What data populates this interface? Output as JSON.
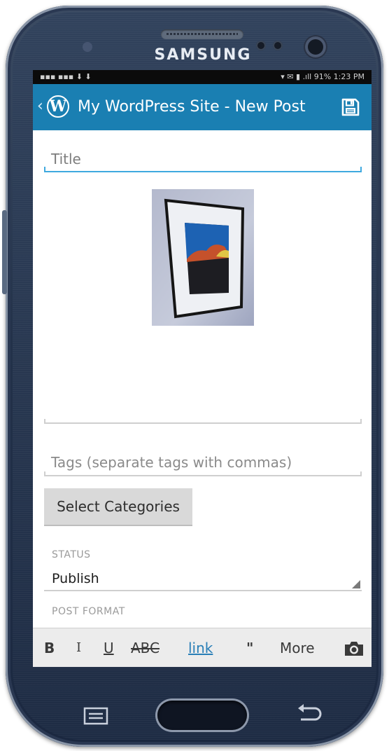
{
  "device": {
    "brand": "SAMSUNG"
  },
  "statusbar": {
    "left": "▪▪▪ ▪▪▪ ⬇ ⬇",
    "right": "▾ ✉ ▮ .ıll 91%  1:23 PM"
  },
  "actionbar": {
    "title": "My WordPress Site - New Post",
    "logo": "W",
    "background_color": "#1a7fb2",
    "back_icon": "chevron-left-icon",
    "save_icon": "floppy-disk-icon"
  },
  "editor": {
    "title_placeholder": "Title",
    "tags_placeholder": "Tags (separate tags with commas)",
    "select_categories_label": "Select Categories",
    "status_label": "STATUS",
    "status_value": "Publish",
    "post_format_label": "POST FORMAT"
  },
  "toolbar": {
    "bold": "B",
    "italic": "I",
    "underline": "U",
    "strikethrough": "ABC",
    "link": "link",
    "quote": "\"",
    "more": "More",
    "camera_icon": "camera-icon"
  }
}
